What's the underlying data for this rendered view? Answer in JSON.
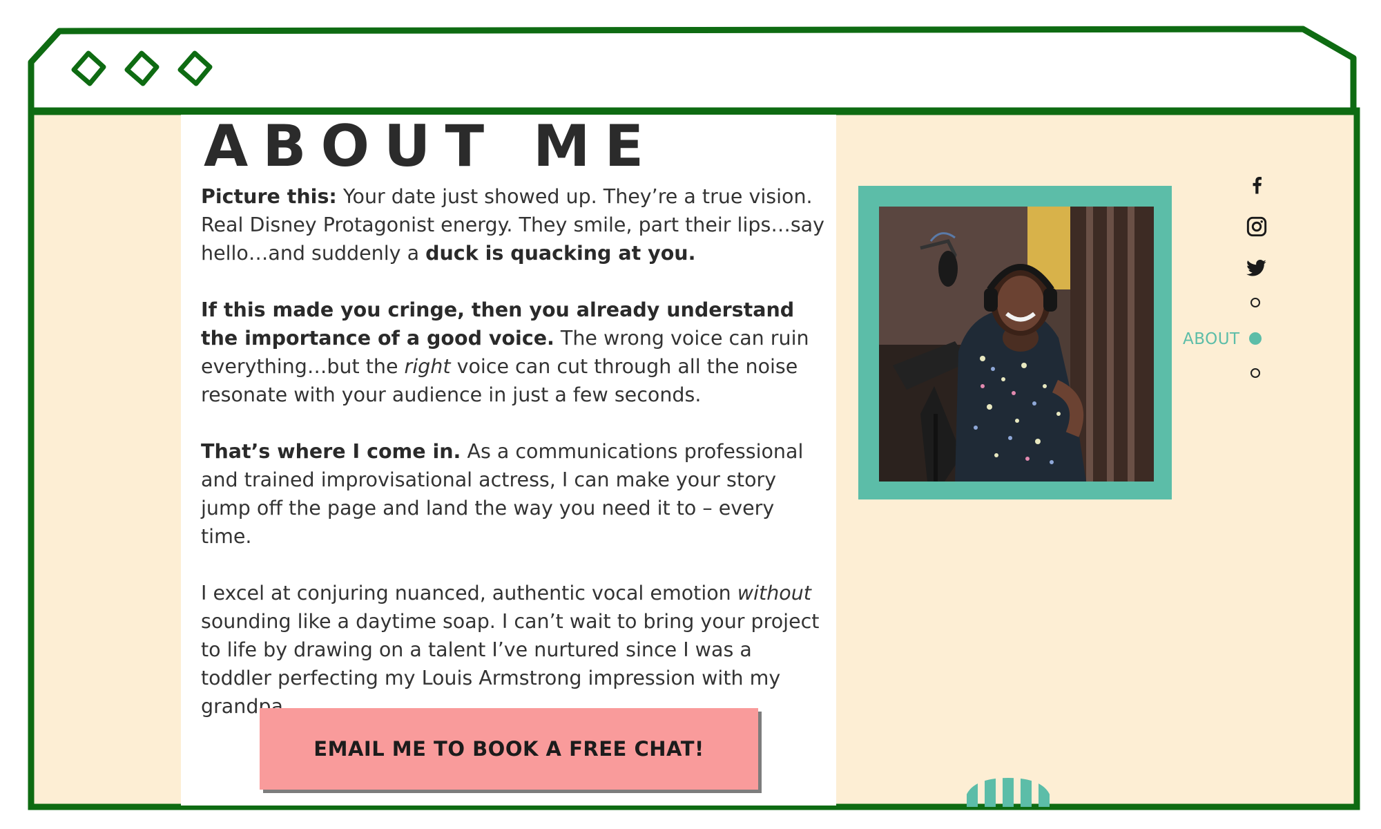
{
  "colors": {
    "frame_green": "#0e6b12",
    "cream": "#fdeed4",
    "teal": "#5cbda8",
    "cta_pink": "#f99b9b",
    "text_dark": "#333333"
  },
  "window": {
    "controls": [
      "diamond-control-icon",
      "diamond-control-icon",
      "diamond-control-icon"
    ]
  },
  "about": {
    "title": "ABOUT ME",
    "p1": {
      "lead": "Picture this:",
      "text": " Your date just showed up. They’re a true vision. Real Disney Protagonist energy. They smile, part their lips…say hello…and suddenly a ",
      "bold_end": "duck is quacking at you."
    },
    "p2": {
      "lead": "If this made you cringe, then you already understand the importance of a good voice.",
      "text1": " The wrong voice can ruin everything…but the ",
      "italic": "right",
      "text2": " voice can cut through all the noise resonate with your audience in just a few seconds."
    },
    "p3": {
      "lead": "That’s where I come in.",
      "text": " As a communications professional and trained improvisational actress, I can make your story jump off the page and land the way you need it to – every time."
    },
    "p4": {
      "text1": "I excel at conjuring nuanced, authentic vocal emotion ",
      "italic": "without",
      "text2": " sounding like a daytime soap. I can’t wait to bring your project to life by drawing on a talent I’ve nurtured since I was a toddler perfecting my Louis Armstrong impression with my grandpa."
    },
    "cta_label": "EMAIL ME TO BOOK A FREE CHAT!"
  },
  "social": [
    "facebook-icon",
    "instagram-icon",
    "twitter-icon"
  ],
  "side_nav": {
    "active_label": "ABOUT",
    "active_index": 1,
    "dots": 3
  }
}
